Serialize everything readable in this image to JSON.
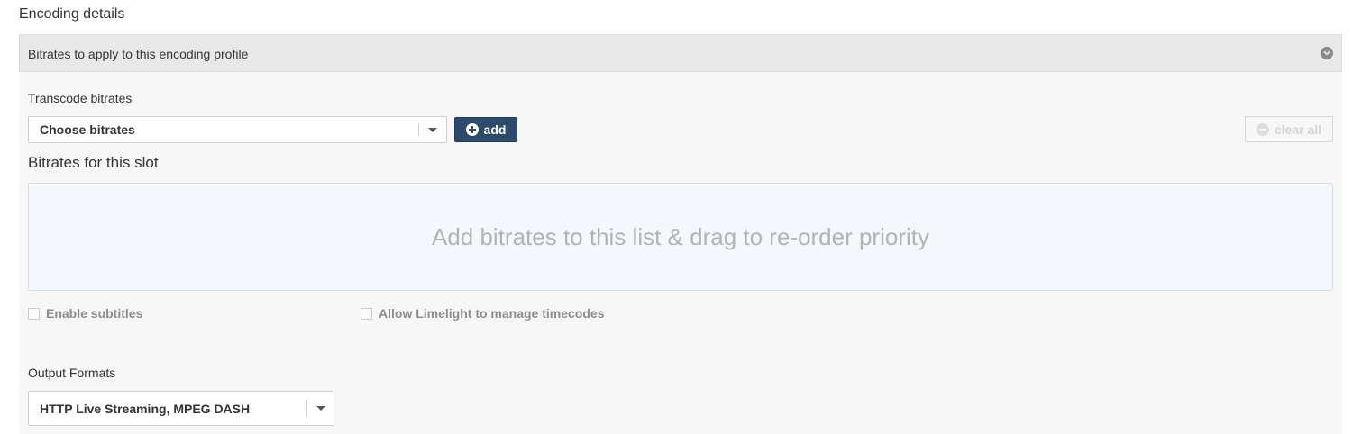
{
  "section": {
    "title": "Encoding details"
  },
  "panel": {
    "header_label": "Bitrates to apply to this encoding profile",
    "toggle_icon": "chevron-down-circle-icon"
  },
  "transcode": {
    "label": "Transcode bitrates",
    "select_value": "Choose bitrates",
    "add_label": "add",
    "clear_label": "clear all"
  },
  "slot": {
    "title": "Bitrates for this slot",
    "dropzone_text": "Add bitrates to this list & drag to re-order priority"
  },
  "options": {
    "enable_subtitles": {
      "label": "Enable subtitles",
      "checked": false
    },
    "limelight_timecodes": {
      "label": "Allow Limelight to manage timecodes",
      "checked": false
    }
  },
  "output": {
    "label": "Output Formats",
    "select_value": "HTTP Live Streaming, MPEG DASH"
  },
  "colors": {
    "add_button": "#2d4a6b",
    "panel_header": "#e8e8e8",
    "panel_body": "#f7f7f7",
    "dropzone_bg": "#f4f8fc"
  }
}
